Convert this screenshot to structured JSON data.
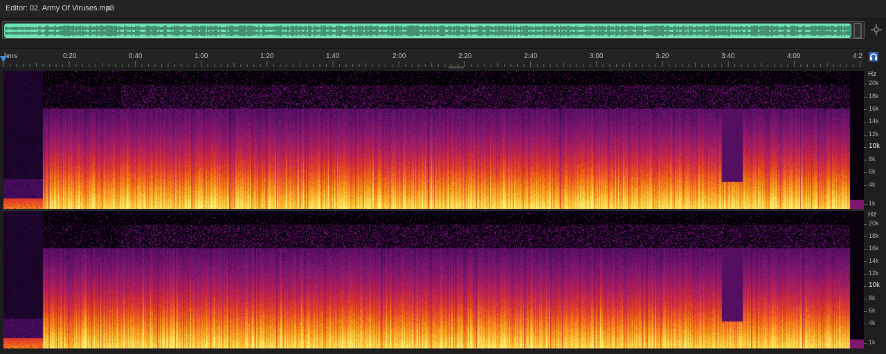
{
  "editor": {
    "title": "Editor: 02. Army Of Viruses.mp3",
    "menu_icon": "hamburger-menu-icon"
  },
  "overview": {
    "waveform_color": "#6fe3b4",
    "zoom_icon": "zoom-navigator-icon"
  },
  "ruler": {
    "format_label": "hms",
    "labels": [
      "0:20",
      "0:40",
      "1:00",
      "1:20",
      "1:40",
      "2:00",
      "2:20",
      "2:40",
      "3:00",
      "3:20",
      "3:40",
      "4:00",
      "4:2"
    ],
    "snap_icon": "headphones-snap-icon"
  },
  "spectrogram": {
    "unit": "Hz",
    "freq_labels": [
      "20k",
      "18k",
      "16k",
      "14k",
      "12k",
      "10k",
      "8k",
      "6k",
      "4k",
      "1k"
    ],
    "highlight_label": "10k",
    "channels": [
      "left",
      "right"
    ],
    "colors": [
      "#000000",
      "#3a0a57",
      "#7a1670",
      "#b31e5a",
      "#e03a2a",
      "#f57a14",
      "#fbc02d",
      "#fff27a"
    ]
  }
}
